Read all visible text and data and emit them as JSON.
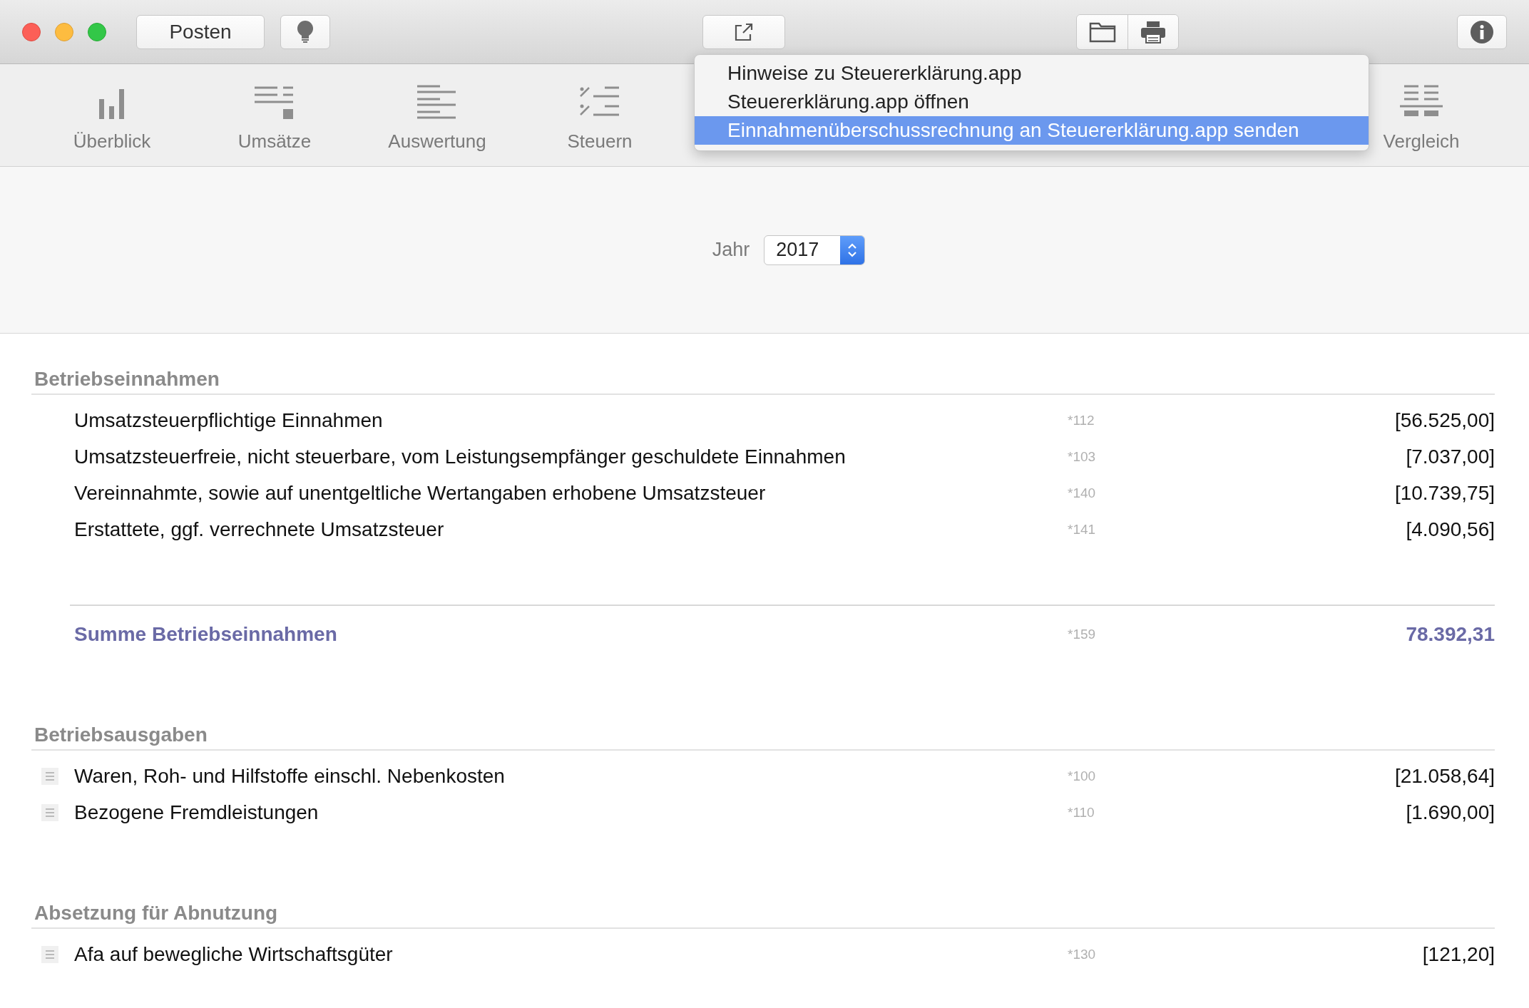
{
  "titlebar": {
    "posten_button": "Posten"
  },
  "toolbar": {
    "items": [
      {
        "label": "Überblick",
        "kind": "bars"
      },
      {
        "label": "Umsätze",
        "kind": "lines"
      },
      {
        "label": "Auswertung",
        "kind": "report"
      },
      {
        "label": "Steuern",
        "kind": "percent"
      },
      {
        "label": "Vergleich",
        "kind": "compare"
      }
    ]
  },
  "share_menu": {
    "items": [
      {
        "label": "Hinweise zu Steuererklärung.app",
        "selected": false
      },
      {
        "label": "Steuererklärung.app öffnen",
        "selected": false
      },
      {
        "label": "Einnahmenüberschussrechnung an Steuererklärung.app senden",
        "selected": true
      }
    ]
  },
  "year": {
    "label": "Jahr",
    "value": "2017"
  },
  "sections": [
    {
      "title": "Betriebseinnahmen",
      "rows": [
        {
          "kind": "plain",
          "label": "Umsatzsteuerpflichtige Einnahmen",
          "code": "*112",
          "amount": "[56.525,00]"
        },
        {
          "kind": "plain",
          "label": "Umsatzsteuerfreie, nicht steuerbare, vom Leistungsempfänger geschuldete Einnahmen",
          "code": "*103",
          "amount": "[7.037,00]"
        },
        {
          "kind": "plain",
          "label": "Vereinnahmte, sowie auf unentgeltliche Wertangaben erhobene Umsatzsteuer",
          "code": "*140",
          "amount": "[10.739,75]"
        },
        {
          "kind": "plain",
          "label": "Erstattete, ggf. verrechnete Umsatzsteuer",
          "code": "*141",
          "amount": "[4.090,56]"
        }
      ],
      "sum": {
        "label": "Summe Betriebseinnahmen",
        "code": "*159",
        "amount": "78.392,31"
      }
    },
    {
      "title": "Betriebsausgaben",
      "rows": [
        {
          "kind": "detail",
          "label": "Waren, Roh- und Hilfstoffe einschl. Nebenkosten",
          "code": "*100",
          "amount": "[21.058,64]"
        },
        {
          "kind": "detail",
          "label": "Bezogene Fremdleistungen",
          "code": "*110",
          "amount": "[1.690,00]"
        }
      ]
    },
    {
      "title": "Absetzung für Abnutzung",
      "rows": [
        {
          "kind": "detail",
          "label": "Afa auf bewegliche Wirtschaftsgüter",
          "code": "*130",
          "amount": "[121,20]"
        }
      ]
    }
  ]
}
